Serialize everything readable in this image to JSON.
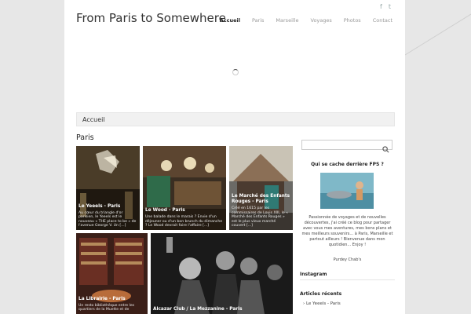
{
  "site": {
    "title": "From Paris to Somewhere"
  },
  "social": [
    {
      "icon": "facebook-icon",
      "glyph": "f"
    },
    {
      "icon": "twitter-icon",
      "glyph": "t"
    }
  ],
  "nav": [
    {
      "label": "Accueil",
      "active": true
    },
    {
      "label": "Paris",
      "active": false
    },
    {
      "label": "Marseille",
      "active": false
    },
    {
      "label": "Voyages",
      "active": false
    },
    {
      "label": "Photos",
      "active": false
    },
    {
      "label": "Contact",
      "active": false
    }
  ],
  "breadcrumb": {
    "label": "Accueil"
  },
  "section": {
    "title": "Paris"
  },
  "posts": [
    {
      "title": "Le Yeeels - Paris",
      "excerpt": "Au cœur du triangle d'or parisien, le Yeeels est le nouveau « THE place to be » de l'avenue George V. Un [...]"
    },
    {
      "title": "Le Wood - Paris",
      "excerpt": "Une balade dans le marais ? Envie d'un déjeuner ou d'un bon brunch du dimanche ? Le Wood devrait faire l'affaire [...]"
    },
    {
      "title": "Le Marché des Enfants Rouges - Paris",
      "excerpt": "Créé en 1615 par les commissaires de Louis XIII, le « Marché des Enfants Rouges » est le plus vieux marché couvert [...]"
    },
    {
      "title": "La Librairie - Paris",
      "excerpt": "Un resto bibliothèque entre les quartiers de la Muette et de"
    },
    {
      "title": "Alcazar Club / La Mezzanine - Paris",
      "excerpt": ""
    }
  ],
  "sidebar": {
    "about_title": "Qui se cache derrière FPS ?",
    "about_text": "Passionnée de voyages et de nouvelles découvertes, j'ai créé ce blog pour partager avec vous mes aventures, mes bons plans et mes meilleurs souvenirs... à Paris, Marseille et partout ailleurs ! Bienvenue dans mon quotidien... Enjoy !",
    "signature": "Purdey Chab's",
    "instagram_title": "Instagram",
    "recent_title": "Articles récents",
    "recent_items": [
      "Le Yeeels - Paris"
    ]
  },
  "colors": {
    "page_bg": "#ffffff",
    "outer_bg": "#e7e7e7",
    "active_nav": "#222222"
  }
}
